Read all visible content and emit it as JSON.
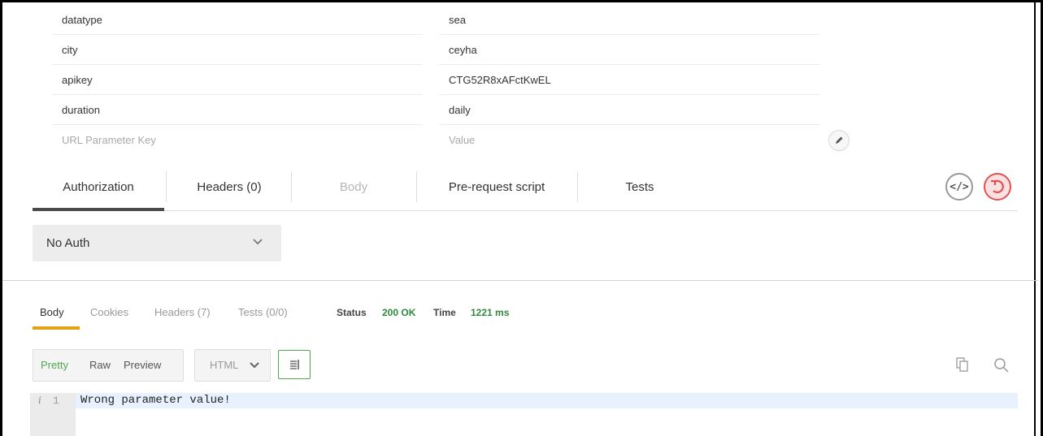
{
  "params": {
    "rows": [
      {
        "key": "datatype",
        "value": "sea"
      },
      {
        "key": "city",
        "value": "ceyha"
      },
      {
        "key": "apikey",
        "value": "CTG52R8xAFctKwEL"
      },
      {
        "key": "duration",
        "value": "daily"
      }
    ],
    "key_placeholder": "URL Parameter Key",
    "value_placeholder": "Value",
    "edit_icon": "pencil-icon"
  },
  "request_tabs": [
    {
      "label": "Authorization",
      "state": "active"
    },
    {
      "label": "Headers (0)",
      "state": "normal"
    },
    {
      "label": "Body",
      "state": "disabled"
    },
    {
      "label": "Pre-request script",
      "state": "normal"
    },
    {
      "label": "Tests",
      "state": "normal"
    }
  ],
  "request_actions": {
    "code_icon": "code-brackets-icon",
    "reset_icon": "reset-icon"
  },
  "auth": {
    "selected": "No Auth"
  },
  "response": {
    "tabs": [
      {
        "label": "Body",
        "state": "active"
      },
      {
        "label": "Cookies",
        "state": "normal"
      },
      {
        "label": "Headers (7)",
        "state": "normal"
      },
      {
        "label": "Tests (0/0)",
        "state": "normal"
      }
    ],
    "status_label": "Status",
    "status_value": "200 OK",
    "time_label": "Time",
    "time_value": "1221 ms",
    "formats": [
      "Pretty",
      "Raw",
      "Preview"
    ],
    "active_format": "Pretty",
    "language": "HTML",
    "code": {
      "info_marker": "i",
      "line_number": "1",
      "text": "Wrong parameter value!"
    }
  },
  "colors": {
    "status_green": "#2e8a3f",
    "active_format_green": "#4ea84e",
    "tab_underline_orange": "#e6a015",
    "reset_red": "#e05353"
  }
}
